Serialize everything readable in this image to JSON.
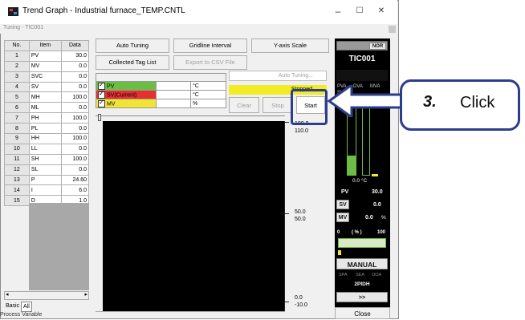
{
  "window": {
    "title": "Trend Graph - Industrial furnace_TEMP.CNTL",
    "subtitle": "Tuning - TIC001",
    "minimize": "–",
    "maximize": "☐",
    "close": "✕"
  },
  "table": {
    "headers": [
      "No.",
      "Item",
      "Data"
    ],
    "rows": [
      [
        "1",
        "PV",
        "30.0"
      ],
      [
        "2",
        "MV",
        "0.0"
      ],
      [
        "3",
        "SVC",
        "0.0"
      ],
      [
        "4",
        "SV",
        "0.0"
      ],
      [
        "5",
        "MH",
        "100.0"
      ],
      [
        "6",
        "ML",
        "0.0"
      ],
      [
        "7",
        "PH",
        "100.0"
      ],
      [
        "8",
        "PL",
        "0.0"
      ],
      [
        "9",
        "HH",
        "100.0"
      ],
      [
        "10",
        "LL",
        "0.0"
      ],
      [
        "11",
        "SH",
        "100.0"
      ],
      [
        "12",
        "SL",
        "0.0"
      ],
      [
        "13",
        "P",
        "24.60"
      ],
      [
        "14",
        "I",
        "6.0"
      ],
      [
        "15",
        "D",
        "1.0"
      ]
    ]
  },
  "tabs": {
    "basic": "Basic",
    "all": "All"
  },
  "status_text": "Process Variable",
  "buttons": {
    "auto_tuning": "Auto Tuning",
    "gridline_interval": "Gridline Interval",
    "y_axis_scale": "Y-axis Scale",
    "collected_tag_list": "Collected Tag List",
    "export_csv": "Export to CSV File",
    "auto_tuning_field": "Auto Tuning...",
    "status": "Stopped",
    "clear": "Clear",
    "stop": "Stop",
    "start": "Start",
    "close": "Close"
  },
  "tags": [
    {
      "name": "PV",
      "unit": "°C",
      "color": "#6cbd45"
    },
    {
      "name": "SV(Current)",
      "unit": "°C",
      "color": "#e53030"
    },
    {
      "name": "MV",
      "unit": "%",
      "color": "#f2e434"
    }
  ],
  "axis": {
    "top_a": "100.0",
    "top_b": "110.0",
    "mid_a": "50.0",
    "mid_b": "50.0",
    "bot_a": "0.0",
    "bot_b": "-10.0"
  },
  "faceplate": {
    "nor": "NOR",
    "tag": "TIC001",
    "bar_labels": [
      "PVA",
      "DVA",
      "MVA"
    ],
    "sva": "SVA",
    "temp_reading": "0.0 °C",
    "pv_label": "PV",
    "pv_value": "30.0",
    "sv_label": "SV",
    "sv_value": "0.0",
    "mv_label": "MV",
    "mv_value": "0.0",
    "mv_unit": "%",
    "scale_min": "0",
    "scale_unit": "( % )",
    "scale_max": "100",
    "mode": "MANUAL",
    "alarms": [
      "SPA",
      "SEA",
      "OOA"
    ],
    "algorithm": "2PIDH",
    "more": ">>",
    "pv_level": 0.25,
    "mv_level": 0.0
  },
  "annotation": {
    "step": "3.",
    "action": "Click"
  }
}
